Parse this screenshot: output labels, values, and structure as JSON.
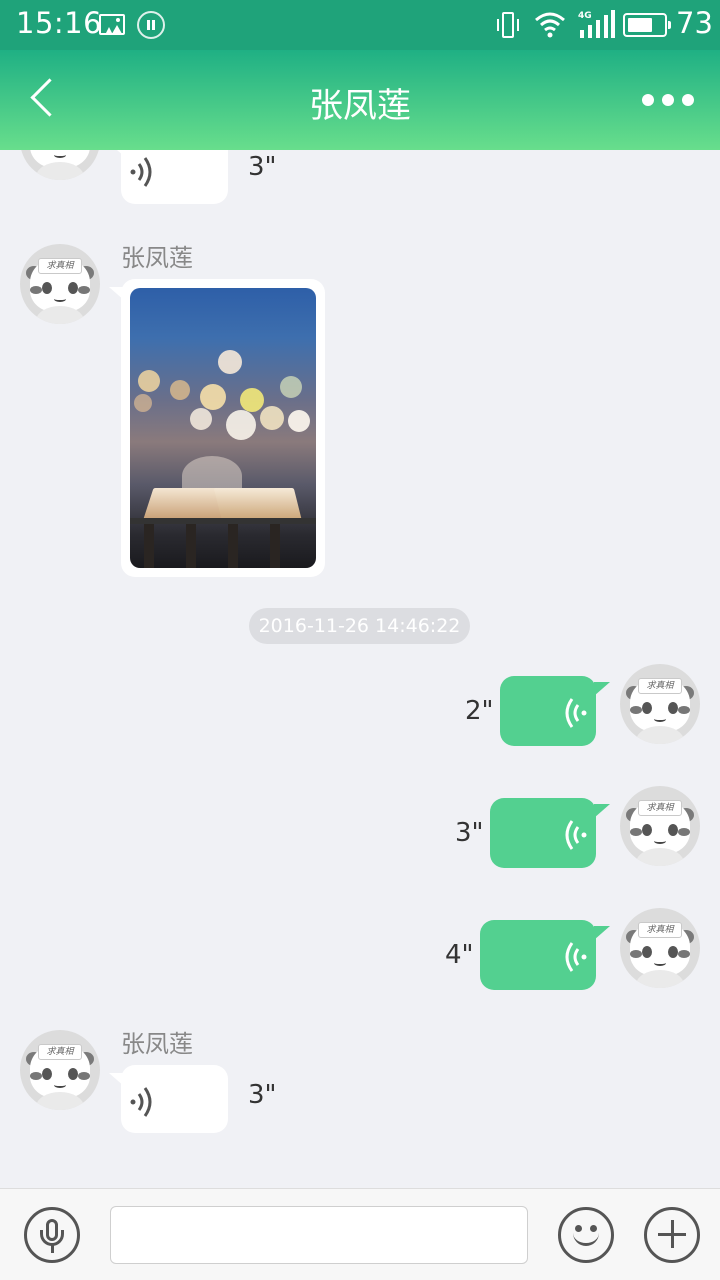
{
  "status_bar": {
    "time": "15:16",
    "network": "4G",
    "battery_level": "73",
    "battery_fraction": 0.73,
    "icons": [
      "image-icon",
      "pause-icon",
      "vibrate-icon",
      "wifi-icon",
      "signal-icon",
      "battery-icon"
    ]
  },
  "header": {
    "title": "张凤莲",
    "back_icon": "chevron-left-icon",
    "more_icon": "more-dots-icon"
  },
  "messages": {
    "m0": {
      "sender": "",
      "type": "voice",
      "duration": "3\""
    },
    "m1": {
      "sender": "张凤莲",
      "type": "image"
    },
    "timestamp": "2016-11-26 14:46:22",
    "m2": {
      "type": "voice",
      "direction": "outgoing",
      "duration": "2\""
    },
    "m3": {
      "type": "voice",
      "direction": "outgoing",
      "duration": "3\""
    },
    "m4": {
      "type": "voice",
      "direction": "outgoing",
      "duration": "4\""
    },
    "m5": {
      "sender": "张凤莲",
      "type": "voice",
      "duration": "3\""
    }
  },
  "input_bar": {
    "text_value": "",
    "placeholder": "",
    "icons": [
      "microphone-icon",
      "emoji-icon",
      "plus-icon"
    ]
  },
  "colors": {
    "status_bar": "#1fa37a",
    "header_top": "#1fb084",
    "header_bottom": "#68de8c",
    "outgoing_bubble": "#53d090",
    "background": "#f0f1f5"
  }
}
